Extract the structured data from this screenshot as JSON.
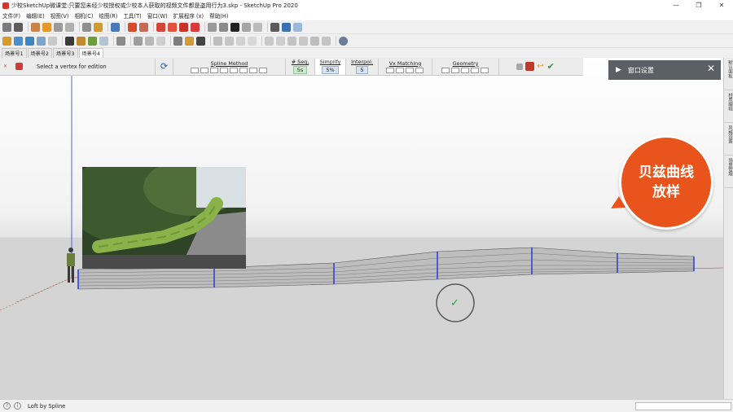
{
  "window": {
    "title": "少校SketchUp微课堂:只要您未经少校授权或少校本人获取的视频文件都是盗用行为3.skp - SketchUp Pro 2020",
    "minimize_glyph": "—",
    "maximize_glyph": "❐",
    "close_glyph": "✕"
  },
  "menu": {
    "items": [
      "文件(F)",
      "编辑(E)",
      "视图(V)",
      "相机(C)",
      "绘图(R)",
      "工具(T)",
      "窗口(W)",
      "扩展程序 (x)",
      "帮助(H)"
    ]
  },
  "scene_tabs": {
    "items": [
      "场景号1",
      "场景号2",
      "场景号3",
      "场景号4"
    ],
    "active_index": 3
  },
  "spline_toolbar": {
    "hint": "Select a vertex for edition",
    "spline_method_label": "Spline Method",
    "seq_label": "# Seq.",
    "seq_value": "5s",
    "simplify_label": "Simplify",
    "simplify_value": "5%",
    "interpol_label": "Interpol.",
    "interpol_value": "5",
    "vx_matching_label": "Vx Matching",
    "geometry_label": "Geometry"
  },
  "window_panel": {
    "title": "窗口设置",
    "arrow_glyph": "▶",
    "close_glyph": "✕"
  },
  "badge": {
    "line1": "贝兹曲线",
    "line2": "放样"
  },
  "status": {
    "text": "Loft by Spline",
    "help_glyph": "?",
    "info_glyph": "i"
  },
  "confirm": {
    "glyph": "✓"
  },
  "right_dock": {
    "items": [
      "默认面板",
      "材质编辑",
      "风格设置",
      "场景管理"
    ]
  },
  "colors": {
    "accent_orange": "#e8541b",
    "panel_dark": "#5b5f66",
    "axis_blue": "#2a3bd1",
    "axis_red": "#d23a3a",
    "confirm_green": "#2c9a4a"
  }
}
